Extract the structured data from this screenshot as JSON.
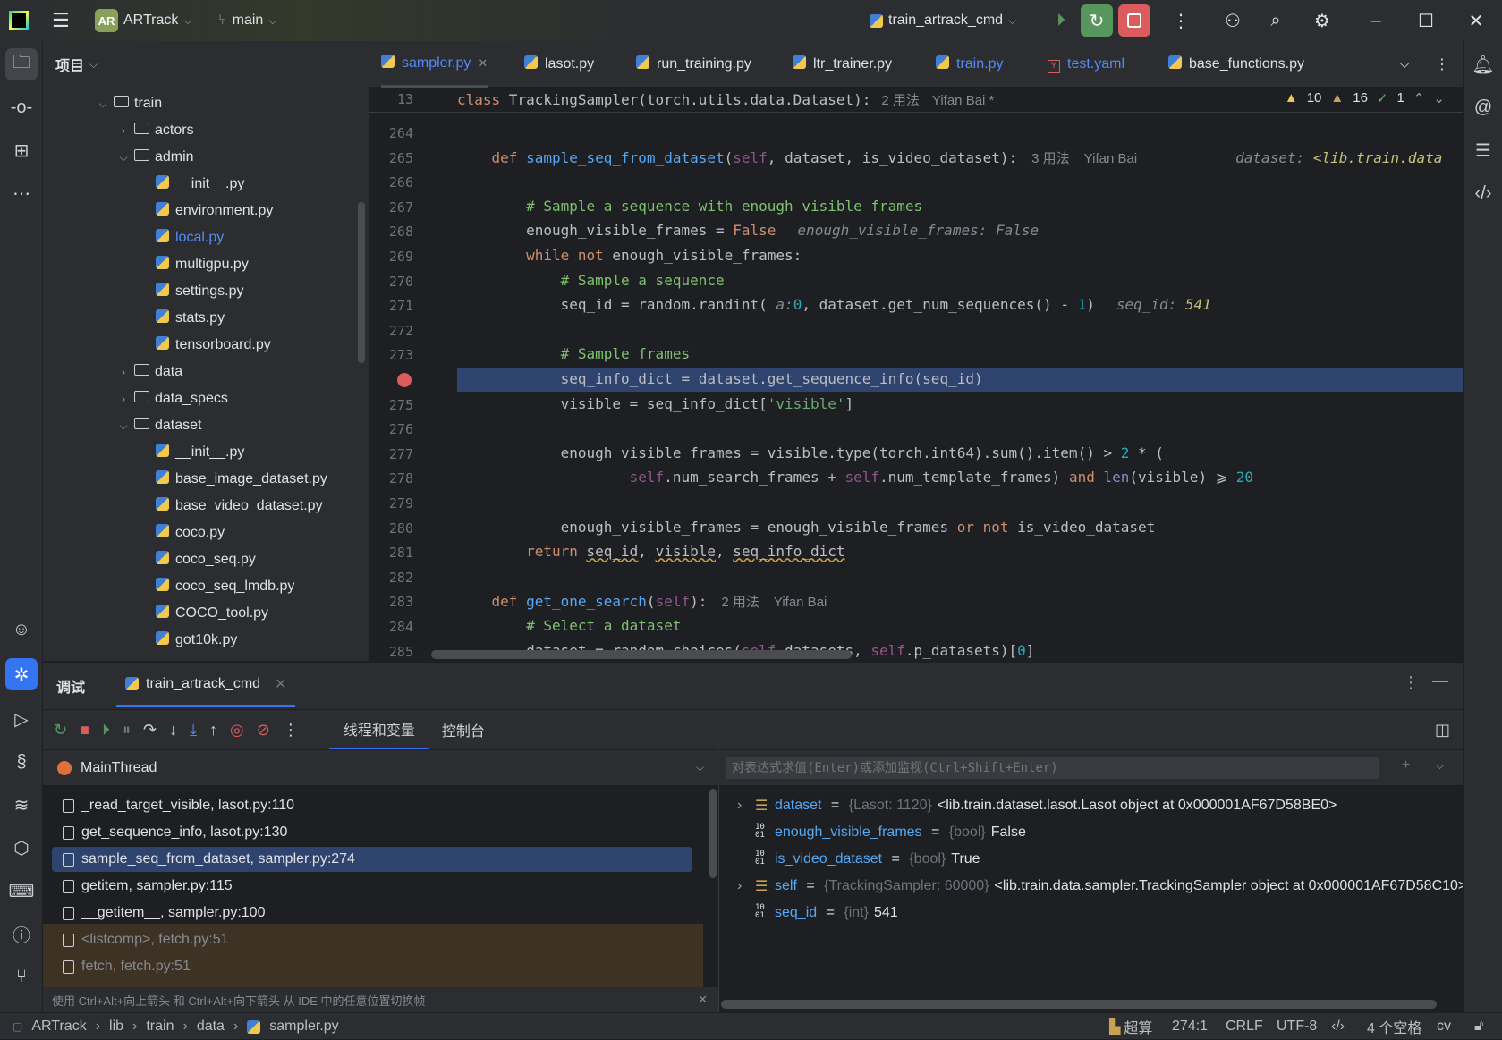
{
  "titlebar": {
    "project_initials": "AR",
    "project": "ARTrack",
    "branch": "main",
    "run_config": "train_artrack_cmd"
  },
  "project_panel": {
    "title": "项目",
    "tree": [
      {
        "label": "train",
        "depth": 0,
        "type": "folder-pkg",
        "open": true
      },
      {
        "label": "actors",
        "depth": 1,
        "type": "folder-pkg",
        "open": false
      },
      {
        "label": "admin",
        "depth": 1,
        "type": "folder-pkg",
        "open": true
      },
      {
        "label": "__init__.py",
        "depth": 2,
        "type": "py"
      },
      {
        "label": "environment.py",
        "depth": 2,
        "type": "py"
      },
      {
        "label": "local.py",
        "depth": 2,
        "type": "py",
        "modified": true
      },
      {
        "label": "multigpu.py",
        "depth": 2,
        "type": "py"
      },
      {
        "label": "settings.py",
        "depth": 2,
        "type": "py"
      },
      {
        "label": "stats.py",
        "depth": 2,
        "type": "py"
      },
      {
        "label": "tensorboard.py",
        "depth": 2,
        "type": "py"
      },
      {
        "label": "data",
        "depth": 1,
        "type": "folder-pkg",
        "open": false
      },
      {
        "label": "data_specs",
        "depth": 1,
        "type": "folder",
        "open": false
      },
      {
        "label": "dataset",
        "depth": 1,
        "type": "folder-pkg",
        "open": true
      },
      {
        "label": "__init__.py",
        "depth": 2,
        "type": "py"
      },
      {
        "label": "base_image_dataset.py",
        "depth": 2,
        "type": "py"
      },
      {
        "label": "base_video_dataset.py",
        "depth": 2,
        "type": "py"
      },
      {
        "label": "coco.py",
        "depth": 2,
        "type": "py"
      },
      {
        "label": "coco_seq.py",
        "depth": 2,
        "type": "py"
      },
      {
        "label": "coco_seq_lmdb.py",
        "depth": 2,
        "type": "py"
      },
      {
        "label": "COCO_tool.py",
        "depth": 2,
        "type": "py"
      },
      {
        "label": "got10k.py",
        "depth": 2,
        "type": "py"
      }
    ]
  },
  "tabs": [
    {
      "label": "sampler.py",
      "active": true,
      "closable": true,
      "icon": "python-icon"
    },
    {
      "label": "lasot.py",
      "icon": "python-icon"
    },
    {
      "label": "run_training.py",
      "icon": "python-icon"
    },
    {
      "label": "ltr_trainer.py",
      "icon": "python-icon"
    },
    {
      "label": "train.py",
      "modified": true,
      "icon": "python-icon"
    },
    {
      "label": "test.yaml",
      "modified": true,
      "icon": "yaml-icon"
    },
    {
      "label": "base_functions.py",
      "icon": "python-icon"
    }
  ],
  "editor": {
    "sticky": {
      "line": "13",
      "tokens": [
        [
          "kw",
          "class "
        ],
        [
          "",
          "TrackingSampler(torch.utils.data.Dataset):"
        ]
      ],
      "usages": "2 用法",
      "author": "Yifan Bai *"
    },
    "inspections": {
      "warnings": "10",
      "weak_warnings": "16",
      "typos": "1"
    },
    "breakpoint_line": "274",
    "lines": [
      {
        "n": "264",
        "i": 0,
        "t": []
      },
      {
        "n": "265",
        "i": 1,
        "t": [
          [
            "kw",
            "def "
          ],
          [
            "fn",
            "sample_seq_from_dataset"
          ],
          [
            "",
            "("
          ],
          [
            "self",
            "self"
          ],
          [
            "",
            ", dataset, is_video_dataset):"
          ]
        ],
        "hint": "3 用法",
        "author": "Yifan Bai",
        "inline": [
          "dataset: ",
          "<lib.train.data"
        ]
      },
      {
        "n": "266",
        "i": 0,
        "t": []
      },
      {
        "n": "267",
        "i": 2,
        "t": [
          [
            "cm",
            "# Sample a sequence with enough visible frames"
          ]
        ]
      },
      {
        "n": "268",
        "i": 2,
        "t": [
          [
            "",
            "enough_visible_frames = "
          ],
          [
            "kw",
            "False"
          ]
        ],
        "inline": [
          "enough_visible_frames: False",
          ""
        ]
      },
      {
        "n": "269",
        "i": 2,
        "t": [
          [
            "kw",
            "while not "
          ],
          [
            "",
            "enough_visible_frames:"
          ]
        ]
      },
      {
        "n": "270",
        "i": 3,
        "t": [
          [
            "cm",
            "# Sample a sequence"
          ]
        ]
      },
      {
        "n": "271",
        "i": 3,
        "t": [
          [
            "",
            "seq_id = random.randint( "
          ],
          [
            "inl",
            "a:"
          ],
          [
            "num",
            "0"
          ],
          [
            "",
            ", dataset.get_num_sequences() - "
          ],
          [
            "num",
            "1"
          ],
          [
            "",
            ")"
          ]
        ],
        "inline": [
          "seq_id: ",
          "541"
        ]
      },
      {
        "n": "272",
        "i": 0,
        "t": []
      },
      {
        "n": "273",
        "i": 3,
        "t": [
          [
            "cm",
            "# Sample frames"
          ]
        ]
      },
      {
        "n": "274",
        "i": 3,
        "t": [
          [
            "",
            "seq_info_dict = dataset.get_sequence_info(seq_id)"
          ]
        ]
      },
      {
        "n": "275",
        "i": 3,
        "t": [
          [
            "",
            "visible = seq_info_dict["
          ],
          [
            "str",
            "'visible'"
          ],
          [
            "",
            "]"
          ]
        ]
      },
      {
        "n": "276",
        "i": 0,
        "t": []
      },
      {
        "n": "277",
        "i": 3,
        "t": [
          [
            "",
            "enough_visible_frames = visible.type(torch.int64).sum().item() > "
          ],
          [
            "num",
            "2"
          ],
          [
            "",
            " * ("
          ]
        ]
      },
      {
        "n": "278",
        "i": 5,
        "t": [
          [
            "self",
            "self"
          ],
          [
            "",
            ".num_search_frames + "
          ],
          [
            "self",
            "self"
          ],
          [
            "",
            ".num_template_frames) "
          ],
          [
            "kw",
            "and "
          ],
          [
            "bi",
            "len"
          ],
          [
            "",
            "(visible) ⩾ "
          ],
          [
            "num",
            "20"
          ]
        ]
      },
      {
        "n": "279",
        "i": 0,
        "t": []
      },
      {
        "n": "280",
        "i": 3,
        "t": [
          [
            "",
            "enough_visible_frames = enough_visible_frames "
          ],
          [
            "kw",
            "or not "
          ],
          [
            "",
            "is_video_dataset"
          ]
        ]
      },
      {
        "n": "281",
        "i": 2,
        "t": [
          [
            "kw",
            "return "
          ],
          [
            "wavy",
            "seq_id"
          ],
          [
            "",
            ", "
          ],
          [
            "wavy",
            "visible"
          ],
          [
            "",
            ", "
          ],
          [
            "wavy",
            "seq_info_dict"
          ]
        ]
      },
      {
        "n": "282",
        "i": 0,
        "t": []
      },
      {
        "n": "283",
        "i": 1,
        "t": [
          [
            "kw",
            "def "
          ],
          [
            "fn",
            "get_one_search"
          ],
          [
            "",
            "("
          ],
          [
            "self",
            "self"
          ],
          [
            "",
            "):"
          ]
        ],
        "hint": "2 用法",
        "author": "Yifan Bai"
      },
      {
        "n": "284",
        "i": 2,
        "t": [
          [
            "cm",
            "# Select a dataset"
          ]
        ]
      },
      {
        "n": "285",
        "i": 2,
        "t": [
          [
            "",
            "dataset = random.choices("
          ],
          [
            "self",
            "self"
          ],
          [
            "",
            ".datasets, "
          ],
          [
            "self",
            "self"
          ],
          [
            "",
            ".p_datasets)["
          ],
          [
            "num",
            "0"
          ],
          [
            "",
            "]"
          ]
        ]
      }
    ]
  },
  "debug": {
    "title": "调试",
    "session_tab": "train_artrack_cmd",
    "subtabs": [
      "线程和变量",
      "控制台"
    ],
    "thread": "MainThread",
    "frames": [
      {
        "label": "_read_target_visible, lasot.py:110"
      },
      {
        "label": "get_sequence_info, lasot.py:130"
      },
      {
        "label": "sample_seq_from_dataset, sampler.py:274",
        "selected": true
      },
      {
        "label": "getitem, sampler.py:115"
      },
      {
        "label": "__getitem__, sampler.py:100"
      },
      {
        "label": "<listcomp>, fetch.py:51",
        "library": true
      },
      {
        "label": "fetch, fetch.py:51",
        "library": true
      }
    ],
    "hint": "使用 Ctrl+Alt+向上箭头 和 Ctrl+Alt+向下箭头 从 IDE 中的任意位置切换帧",
    "eval_placeholder": "对表达式求值(Enter)或添加监视(Ctrl+Shift+Enter)",
    "variables": [
      {
        "name": "dataset",
        "type": "{Lasot: 1120}",
        "value": "<lib.train.dataset.lasot.Lasot object at 0x000001AF67D58BE0>",
        "expandable": true
      },
      {
        "name": "enough_visible_frames",
        "type": "{bool}",
        "value": "False"
      },
      {
        "name": "is_video_dataset",
        "type": "{bool}",
        "value": "True"
      },
      {
        "name": "self",
        "type": "{TrackingSampler: 60000}",
        "value": "<lib.train.data.sampler.TrackingSampler object at 0x000001AF67D58C10>",
        "expandable": true
      },
      {
        "name": "seq_id",
        "type": "{int}",
        "value": "541"
      }
    ]
  },
  "statusbar": {
    "breadcrumb": [
      "ARTrack",
      "lib",
      "train",
      "data",
      "sampler.py"
    ],
    "sftp": "超算",
    "position": "274:1",
    "line_sep": "CRLF",
    "encoding": "UTF-8",
    "indent": "4 个空格",
    "interpreter": "cv"
  },
  "colors": {
    "accent": "#3574f0",
    "run_green": "#57965c",
    "stop_red": "#db5c5c",
    "selection": "#2e436e",
    "breakpoint": "#db5c5c"
  }
}
